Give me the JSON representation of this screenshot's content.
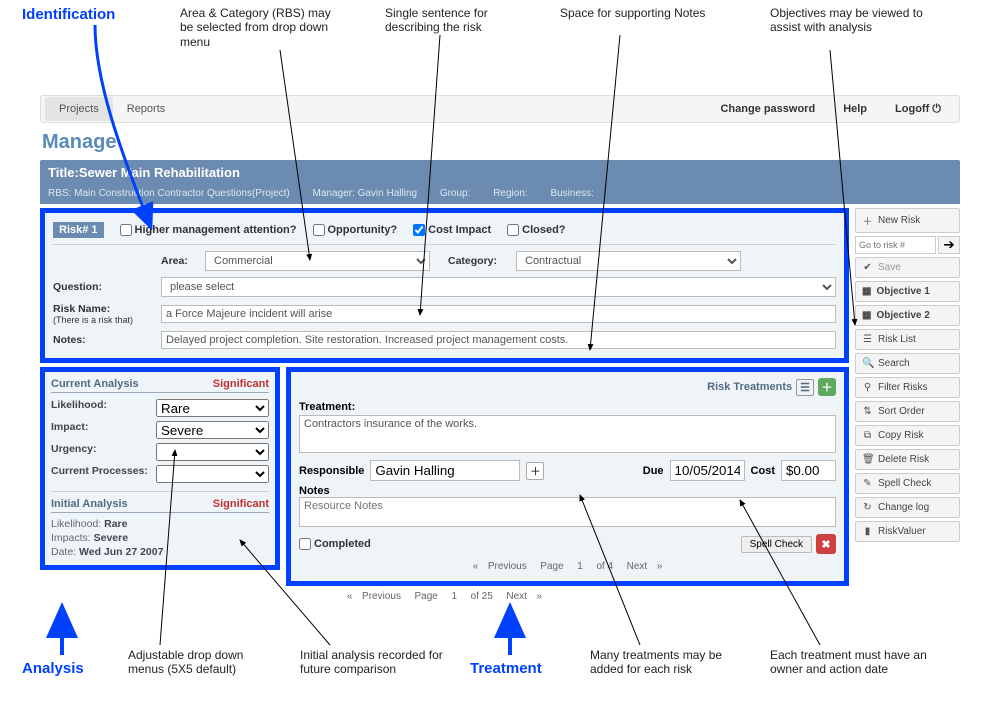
{
  "annotations": {
    "identification": "Identification",
    "area_cat": "Area & Category (RBS) may be selected from drop down menu",
    "single_sentence": "Single sentence for describing the risk",
    "space_notes": "Space for supporting Notes",
    "objectives": "Objectives may be viewed to assist with analysis",
    "analysis": "Analysis",
    "dropdown_55": "Adjustable drop down menus (5X5 default)",
    "initial_rec": "Initial analysis recorded for future comparison",
    "treatment": "Treatment",
    "many_treat": "Many treatments may be added for each risk",
    "treat_owner": "Each treatment must have an owner and action date"
  },
  "nav": {
    "projects": "Projects",
    "reports": "Reports",
    "change_pw": "Change password",
    "help": "Help",
    "logoff": "Logoff"
  },
  "page": {
    "title": "Manage"
  },
  "project": {
    "title": "Title:Sewer Main Rehabilitation",
    "rbs": "RBS: Main Construction Contractor Questions(Project)",
    "manager": "Manager: Gavin Halling",
    "group": "Group:",
    "region": "Region:",
    "business": "Business:"
  },
  "risk": {
    "id": "Risk# 1",
    "checks": {
      "higher_mgmt": "Higher management attention?",
      "opportunity": "Opportunity?",
      "cost_impact": "Cost Impact",
      "closed": "Closed?"
    },
    "area_label": "Area:",
    "area_value": "Commercial",
    "category_label": "Category:",
    "category_value": "Contractual",
    "question_label": "Question:",
    "question_value": "please select",
    "name_label": "Risk Name:",
    "name_sub": "(There is a risk that)",
    "name_value": "a Force Majeure incident will arise",
    "notes_label": "Notes:",
    "notes_value": "Delayed project completion. Site restoration. Increased project management costs."
  },
  "current_analysis": {
    "title": "Current Analysis",
    "rating": "Significant",
    "likelihood_label": "Likelihood:",
    "likelihood_value": "Rare",
    "impact_label": "Impact:",
    "impact_value": "Severe",
    "urgency_label": "Urgency:",
    "processes_label": "Current Processes:"
  },
  "initial_analysis": {
    "title": "Initial Analysis",
    "rating": "Significant",
    "likelihood": "Likelihood: Rare",
    "impacts": "Impacts: Severe",
    "date": "Date: Wed Jun 27 2007"
  },
  "treatments": {
    "title": "Risk Treatments",
    "treatment_label": "Treatment:",
    "treatment_value": "Contractors insurance of the works.",
    "responsible_label": "Responsible",
    "responsible_value": "Gavin Halling",
    "due_label": "Due",
    "due_value": "10/05/2014",
    "cost_label": "Cost",
    "cost_value": "$0.00",
    "notes_label": "Notes",
    "notes_placeholder": "Resource Notes",
    "completed_label": "Completed",
    "spell_check": "Spell Check",
    "pager": {
      "prev": "Previous",
      "page": "Page",
      "current": "1",
      "of": "of 4",
      "next": "Next"
    },
    "pager2": {
      "prev": "Previous",
      "page": "Page",
      "current": "1",
      "of": "of 25",
      "next": "Next"
    }
  },
  "sidebar": {
    "new_risk": "New Risk",
    "goto_placeholder": "Go to risk #",
    "save": "Save",
    "obj1": "Objective 1",
    "obj2": "Objective 2",
    "risk_list": "Risk List",
    "search": "Search",
    "filter": "Filter Risks",
    "sort": "Sort Order",
    "copy": "Copy Risk",
    "delete": "Delete Risk",
    "spell": "Spell Check",
    "changelog": "Change log",
    "riskvaluer": "RiskValuer"
  }
}
